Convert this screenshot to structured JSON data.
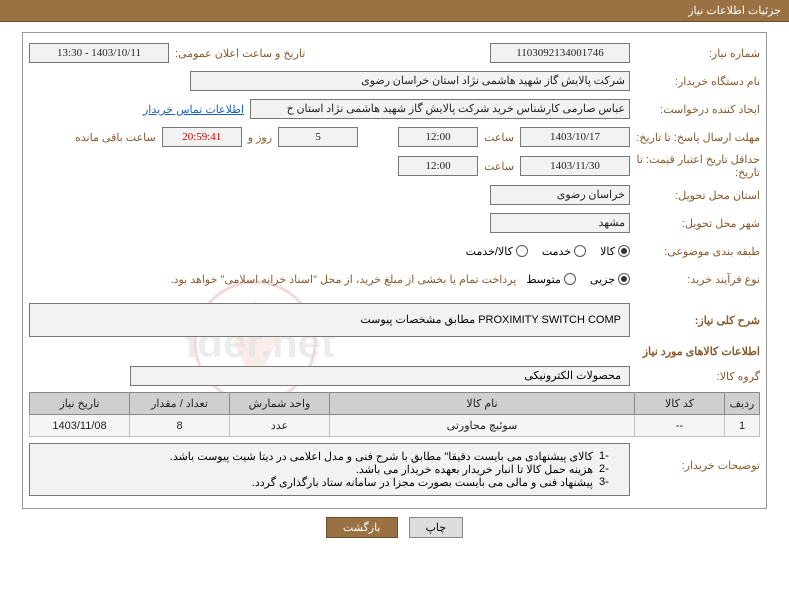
{
  "header": {
    "title": "جزئیات اطلاعات نیاز"
  },
  "need": {
    "number_label": "شماره نیاز:",
    "number": "1103092134001746",
    "announce_label": "تاریخ و ساعت اعلان عمومی:",
    "announce": "1403/10/11 - 13:30",
    "buyer_label": "نام دستگاه خریدار:",
    "buyer": "شرکت پالایش گاز شهید هاشمی نژاد   استان خراسان رضوی",
    "requester_label": "ایجاد کننده درخواست:",
    "requester": "عباس صارمی کارشناس خرید  شرکت پالایش گاز شهید هاشمی نژاد   استان خ",
    "contact_link": "اطلاعات تماس خریدار",
    "deadline_label": "مهلت ارسال پاسخ: تا تاریخ:",
    "deadline_date": "1403/10/17",
    "time_label": "ساعت",
    "deadline_time": "12:00",
    "days": "5",
    "days_label": "روز و",
    "remain_time": "20:59:41",
    "remain_label": "ساعت باقی مانده",
    "validity_label": "حداقل تاریخ اعتبار قیمت: تا تاریخ:",
    "validity_date": "1403/11/30",
    "validity_time": "12:00",
    "province_label": "استان محل تحویل:",
    "province": "خراسان رضوی",
    "city_label": "شهر محل تحویل:",
    "city": "مشهد",
    "category_label": "طبقه بندی موضوعی:",
    "category_options": {
      "goods": "کالا",
      "service": "خدمت",
      "both": "کالا/خدمت"
    },
    "process_label": "نوع فرآیند خرید:",
    "process_options": {
      "partial": "جزیی",
      "medium": "متوسط"
    },
    "process_note": "پرداخت تمام یا بخشی از مبلغ خرید، از محل \"اسناد خزانه اسلامی\" خواهد بود."
  },
  "summary": {
    "label": "شرح کلی نیاز:",
    "text": "PROXIMITY SWITCH COMP مطابق مشخصات پیوست"
  },
  "items": {
    "section_title": "اطلاعات کالاهای مورد نیاز",
    "group_label": "گروه کالا:",
    "group": "محصولات الکترونیکی",
    "headers": {
      "row": "ردیف",
      "code": "کد کالا",
      "name": "نام کالا",
      "unit": "واحد شمارش",
      "qty": "تعداد / مقدار",
      "date": "تاریخ نیاز"
    },
    "rows": [
      {
        "row": "1",
        "code": "--",
        "name": "سوئیچ مجاورتی",
        "unit": "عدد",
        "qty": "8",
        "date": "1403/11/08"
      }
    ]
  },
  "notes": {
    "label": "توضیحات خریدار:",
    "lines": [
      "کالای پیشنهادی می بایست دقیقا\" مطابق با شرح فنی و مدل اعلامی در دیتا شیت پیوست باشد.",
      "هزینه حمل کالا تا انبار خریدار بعهده خریدار می باشد.",
      "پیشنهاد فنی و مالی می بایست بصورت مجزا در سامانه ستاد بارگذاری گردد."
    ]
  },
  "buttons": {
    "print": "چاپ",
    "back": "بازگشت"
  }
}
